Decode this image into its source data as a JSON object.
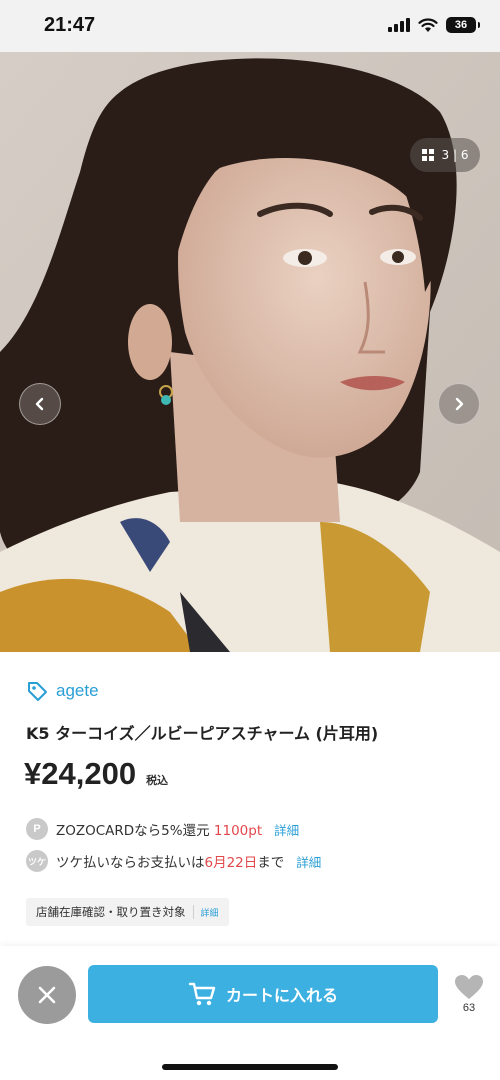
{
  "status_bar": {
    "time": "21:47",
    "battery": "36"
  },
  "gallery": {
    "current": "3",
    "separator": "|",
    "total": "6",
    "icons": {
      "grid": "grid-icon",
      "prev": "chevron-left-icon",
      "next": "chevron-right-icon"
    }
  },
  "product": {
    "brand": "agete",
    "brand_icon": "tag-icon",
    "title": "K5 ターコイズ／ルビーピアスチャーム (片耳用)",
    "price": "¥24,200",
    "tax_label": "税込"
  },
  "offers": [
    {
      "icon_text": "P",
      "text_before": "ZOZOCARDなら5%還元 ",
      "highlight": "1100pt",
      "text_after": "",
      "link": "詳細"
    },
    {
      "icon_text": "ツケ",
      "text_before": "ツケ払いならお支払いは",
      "highlight": "6月22日",
      "text_after": "まで",
      "link": "詳細"
    }
  ],
  "store_chip": {
    "label": "店舗在庫確認・取り置き対象",
    "link": "詳細"
  },
  "actions": {
    "cart_label": "カートに入れる",
    "cart_icon": "cart-icon",
    "close_icon": "close-icon",
    "favorite_icon": "heart-icon",
    "favorite_count": "63"
  },
  "colors": {
    "accent": "#2a9fd6",
    "cart_button": "#3db0e2",
    "highlight_red": "#e2474b"
  }
}
